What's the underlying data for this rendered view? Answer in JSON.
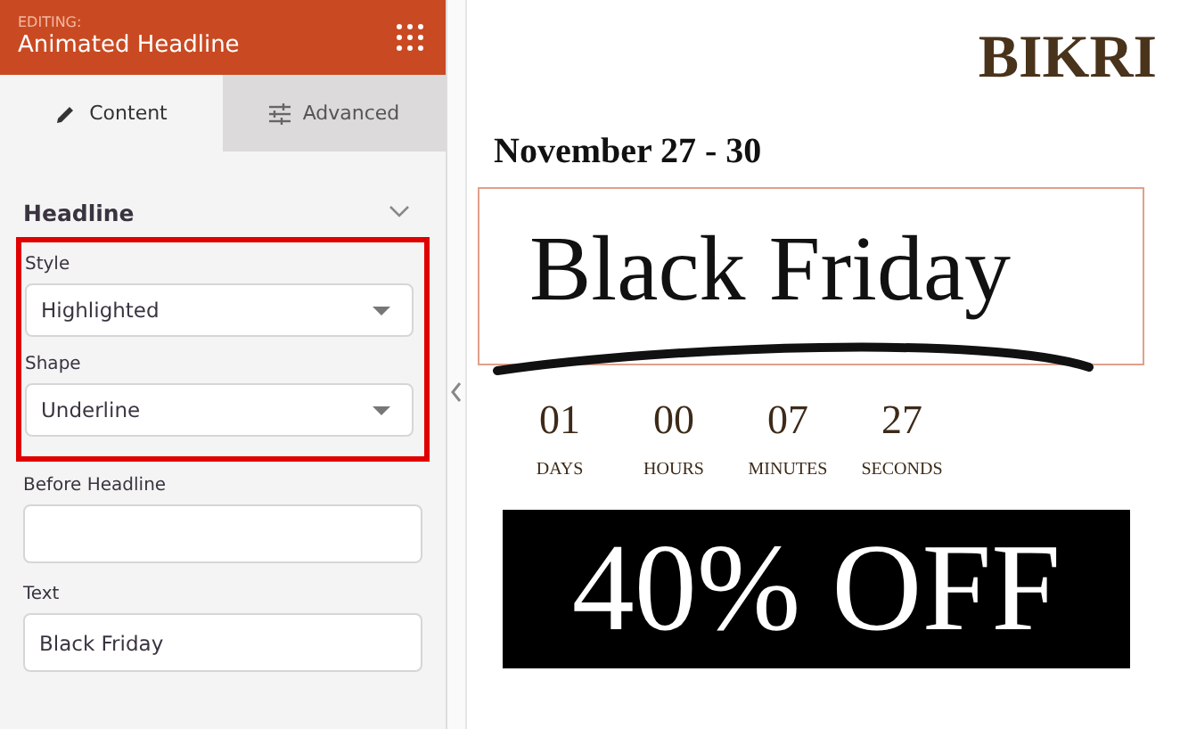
{
  "panel": {
    "editing_label": "EDITING:",
    "title": "Animated Headline"
  },
  "tabs": [
    {
      "label": "Content",
      "kind": "pencil",
      "selected": true
    },
    {
      "label": "Advanced",
      "kind": "sliders",
      "selected": false
    }
  ],
  "section": {
    "title": "Headline",
    "expanded": true
  },
  "highlight_box": {
    "fields": [
      {
        "label": "Style",
        "kind": "select",
        "value": "Highlighted"
      },
      {
        "label": "Shape",
        "kind": "select",
        "value": "Underline"
      }
    ]
  },
  "fields": [
    {
      "label": "Before Headline",
      "kind": "input"
    },
    {
      "label": "Text",
      "kind": "input",
      "value": "Black Friday"
    }
  ],
  "preview": {
    "brand": "BIKRI",
    "dates": "November 27 - 30",
    "headline": "Black Friday",
    "underlined": true,
    "countdown": [
      {
        "value": "01",
        "unit": "DAYS"
      },
      {
        "value": "00",
        "unit": "HOURS"
      },
      {
        "value": "07",
        "unit": "MINUTES"
      },
      {
        "value": "27",
        "unit": "SECONDS"
      }
    ],
    "banner": "40% OFF"
  }
}
